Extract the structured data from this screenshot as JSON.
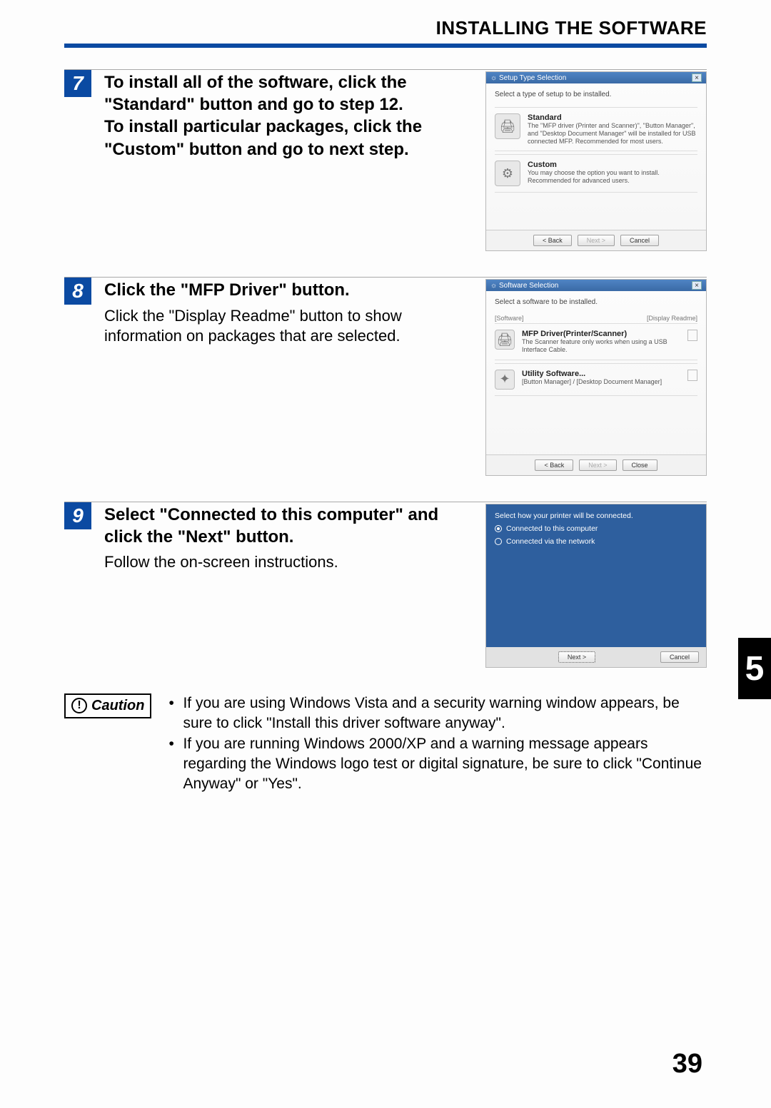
{
  "header": {
    "title": "INSTALLING THE SOFTWARE"
  },
  "chapter_tab": "5",
  "page_number": "39",
  "step7": {
    "num": "7",
    "heading": "To install all of the software, click the \"Standard\" button and go to step 12.\nTo install particular packages, click the \"Custom\" button and go to next step.",
    "shot": {
      "title": "Setup Type Selection",
      "instruction": "Select a type of setup to be installed.",
      "standard": {
        "label": "Standard",
        "desc": "The \"MFP driver (Printer and Scanner)\", \"Button Manager\", and \"Desktop Document Manager\" will be installed for USB connected MFP. Recommended for most users."
      },
      "custom": {
        "label": "Custom",
        "desc": "You may choose the option you want to install. Recommended for advanced users."
      },
      "btn_back": "< Back",
      "btn_next": "Next >",
      "btn_cancel": "Cancel"
    }
  },
  "step8": {
    "num": "8",
    "heading": "Click the \"MFP Driver\" button.",
    "body": "Click the \"Display Readme\" button to show information on packages that are selected.",
    "shot": {
      "title": "Software Selection",
      "instruction": "Select a software to be installed.",
      "label_software": "[Software]",
      "label_readme": "[Display Readme]",
      "mfp": {
        "label": "MFP Driver(Printer/Scanner)",
        "desc": "The Scanner feature only works when using a USB Interface Cable."
      },
      "util": {
        "label": "Utility Software...",
        "desc": "[Button Manager] / [Desktop Document Manager]"
      },
      "btn_back": "< Back",
      "btn_next": "Next >",
      "btn_close": "Close"
    }
  },
  "step9": {
    "num": "9",
    "heading": "Select \"Connected to this computer\" and click the \"Next\" button.",
    "body": "Follow the on-screen instructions.",
    "shot": {
      "instruction": "Select how your printer will be connected.",
      "opt1": "Connected to this computer",
      "opt2": "Connected via the network",
      "btn_next": "Next >",
      "btn_cancel": "Cancel"
    }
  },
  "caution": {
    "label": "Caution",
    "item1": "If you are using Windows Vista and a security warning window appears, be sure to click \"Install this driver software anyway\".",
    "item2": "If you are running Windows 2000/XP and a warning message appears regarding the Windows logo test or digital signature, be sure to click \"Continue Anyway\" or \"Yes\"."
  }
}
